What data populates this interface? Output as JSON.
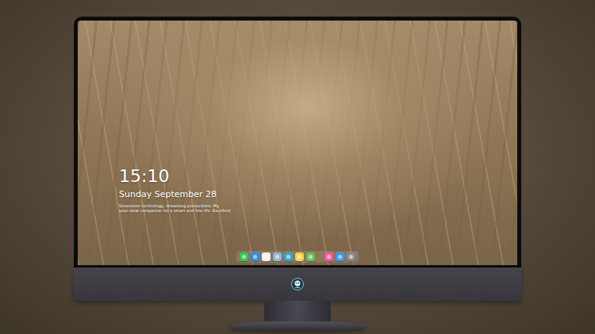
{
  "lock_screen": {
    "time": "15:10",
    "date": "Sunday September 28",
    "caption": [
      "Seventeen technology, streaming productions. My",
      "your ideal companion for a smart and fine life. Excellent"
    ]
  },
  "dock": {
    "items": [
      {
        "color": "#34c759"
      },
      {
        "color": "#2f8ee8"
      },
      {
        "color": "#f2f2f2"
      },
      {
        "color": "#8fb6d8"
      },
      {
        "color": "#3aa7c9"
      },
      {
        "color": "#f6d24a"
      },
      {
        "color": "#6bbf59"
      },
      {
        "color": "#f25c9a"
      },
      {
        "color": "#3b9cf0"
      },
      {
        "color": "#8a8a8a"
      }
    ]
  }
}
